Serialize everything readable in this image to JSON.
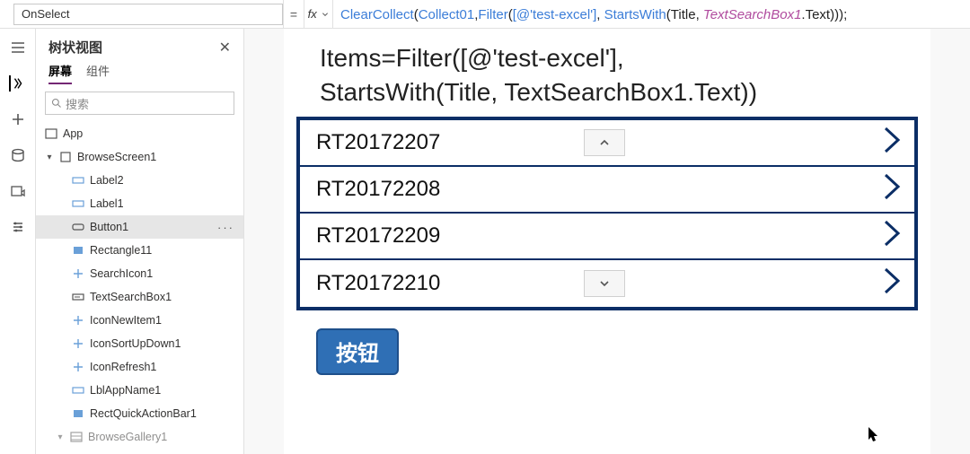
{
  "property_selector": {
    "value": "OnSelect"
  },
  "formula": {
    "eq": "=",
    "fx": "fx",
    "fn1": "ClearCollect",
    "collectVar": "Collect01",
    "fn2": "Filter",
    "src": "[@'test-excel']",
    "fn3": "StartsWith",
    "title": "Title",
    "searchObj": "TextSearchBox1",
    "textProp": ".Text)));"
  },
  "tree": {
    "title": "树状视图",
    "tabs": {
      "screens": "屏幕",
      "components": "组件"
    },
    "search_placeholder": "搜索",
    "app": "App",
    "screen": "BrowseScreen1",
    "items": [
      {
        "label": "Label2"
      },
      {
        "label": "Label1"
      },
      {
        "label": "Button1",
        "selected": true
      },
      {
        "label": "Rectangle11"
      },
      {
        "label": "SearchIcon1"
      },
      {
        "label": "TextSearchBox1"
      },
      {
        "label": "IconNewItem1"
      },
      {
        "label": "IconSortUpDown1"
      },
      {
        "label": "IconRefresh1"
      },
      {
        "label": "LblAppName1"
      },
      {
        "label": "RectQuickActionBar1"
      },
      {
        "label": "BrowseGallery1"
      }
    ]
  },
  "canvas": {
    "items_text_l1": "Items=Filter([@'test-excel'],",
    "items_text_l2": "StartsWith(Title, TextSearchBox1.Text))",
    "rows": [
      {
        "title": "RT20172207",
        "up": true
      },
      {
        "title": "RT20172208"
      },
      {
        "title": "RT20172209"
      },
      {
        "title": "RT20172210",
        "down": true
      }
    ],
    "button_label": "按钮"
  }
}
